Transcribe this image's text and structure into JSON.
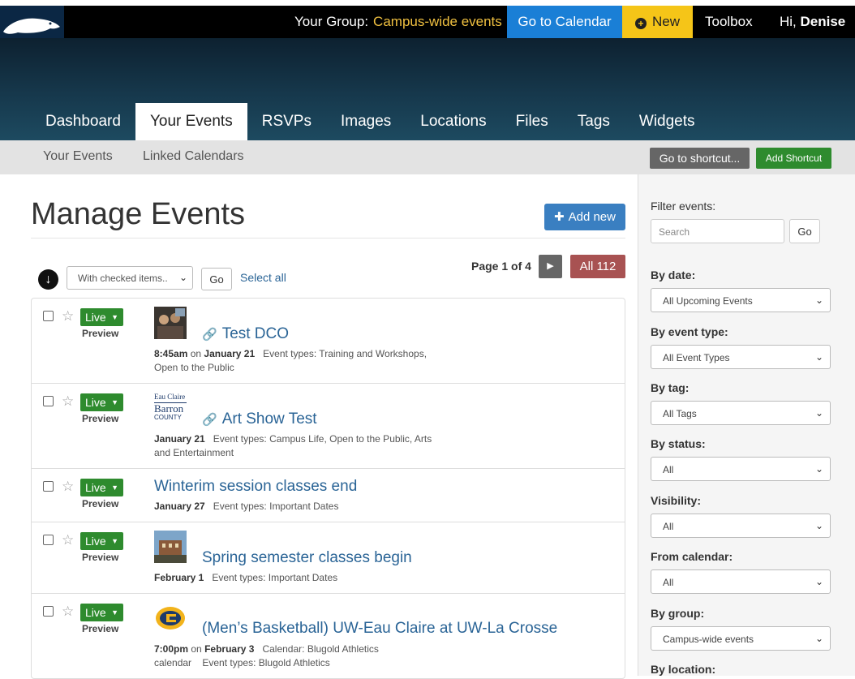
{
  "topbar": {
    "group_label": "Your Group:",
    "group_value": "Campus-wide events",
    "calendar_button": "Go to Calendar",
    "new_button": "New",
    "toolbox": "Toolbox",
    "greeting": "Hi,",
    "user": "Denise"
  },
  "main_tabs": [
    "Dashboard",
    "Your Events",
    "RSVPs",
    "Images",
    "Locations",
    "Files",
    "Tags",
    "Widgets"
  ],
  "sub_nav": {
    "items": [
      "Your Events",
      "Linked Calendars"
    ],
    "shortcut_button": "Go to shortcut...",
    "add_shortcut_button": "Add Shortcut"
  },
  "page": {
    "title": "Manage Events",
    "add_new": "Add new",
    "bulk_select": "With checked items..",
    "go": "Go",
    "select_all": "Select all",
    "page_info": "Page 1 of 4",
    "all_count": "All 112"
  },
  "events": [
    {
      "status": "Live",
      "preview": "Preview",
      "title": "Test DCO",
      "linked": true,
      "time": "8:45am",
      "on": "on",
      "date": "January 21",
      "meta_line1": "Event types: Training and Workshops,",
      "meta_line2": "Open to the Public",
      "thumb": "photo"
    },
    {
      "status": "Live",
      "preview": "Preview",
      "title": "Art Show Test",
      "linked": true,
      "time": "",
      "on": "",
      "date": "January 21",
      "meta_line1": "Event types: Campus Life, Open to the Public, Arts",
      "meta_line2": "and Entertainment",
      "thumb": "barron"
    },
    {
      "status": "Live",
      "preview": "Preview",
      "title": "Winterim session classes end",
      "linked": false,
      "time": "",
      "on": "",
      "date": "January 27",
      "meta_line1": "Event types: Important Dates",
      "meta_line2": "",
      "thumb": ""
    },
    {
      "status": "Live",
      "preview": "Preview",
      "title": "Spring semester classes begin",
      "linked": false,
      "time": "",
      "on": "",
      "date": "February 1",
      "meta_line1": "Event types: Important Dates",
      "meta_line2": "",
      "thumb": "building"
    },
    {
      "status": "Live",
      "preview": "Preview",
      "title": "(Men’s Basketball) UW-Eau Claire at UW-La Crosse",
      "linked": false,
      "time": "7:00pm",
      "on": "on",
      "date": "February 3",
      "meta_line1": "Calendar: Blugold Athletics",
      "meta_line2": "calendar    Event types: Blugold Athletics",
      "thumb": "logo"
    }
  ],
  "thumb_text": {
    "barron_top": "Eau Claire",
    "barron_mid": "Barron",
    "barron_bottom": "COUNTY"
  },
  "sidebar": {
    "filter_label": "Filter events:",
    "search_placeholder": "Search",
    "go": "Go",
    "filters": [
      {
        "label": "By date:",
        "value": "All Upcoming Events"
      },
      {
        "label": "By event type:",
        "value": "All Event Types"
      },
      {
        "label": "By tag:",
        "value": "All Tags"
      },
      {
        "label": "By status:",
        "value": "All"
      },
      {
        "label": "Visibility:",
        "value": "All"
      },
      {
        "label": "From calendar:",
        "value": "All"
      },
      {
        "label": "By group:",
        "value": "Campus-wide events"
      },
      {
        "label": "By location:",
        "value": ""
      }
    ]
  },
  "colors": {
    "calendar_button": "#1a7fd6",
    "new_button": "#f5c518",
    "live": "#2e8b2e",
    "all_badge": "#a85252",
    "link": "#2a6496"
  }
}
